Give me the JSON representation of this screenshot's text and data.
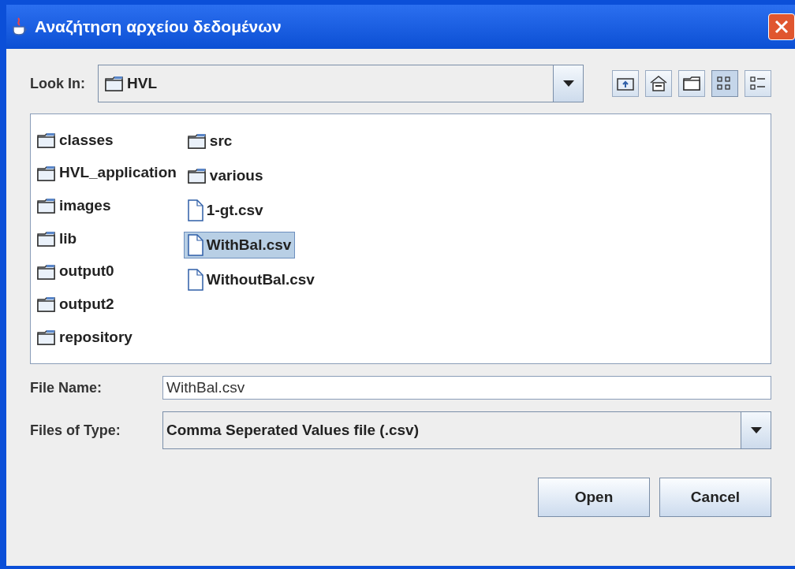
{
  "window": {
    "title": "Αναζήτηση αρχείου δεδομένων"
  },
  "look_in": {
    "label": "Look In:",
    "value": "HVL"
  },
  "toolbar": [
    {
      "kind": "up",
      "selected": false
    },
    {
      "kind": "home",
      "selected": false
    },
    {
      "kind": "new-folder",
      "selected": false
    },
    {
      "kind": "list",
      "selected": true
    },
    {
      "kind": "details",
      "selected": false
    }
  ],
  "files": [
    {
      "name": "classes",
      "kind": "folder",
      "selected": false
    },
    {
      "name": "HVL_application",
      "kind": "folder",
      "selected": false
    },
    {
      "name": "images",
      "kind": "folder",
      "selected": false
    },
    {
      "name": "lib",
      "kind": "folder",
      "selected": false
    },
    {
      "name": "output0",
      "kind": "folder",
      "selected": false
    },
    {
      "name": "output2",
      "kind": "folder",
      "selected": false
    },
    {
      "name": "repository",
      "kind": "folder",
      "selected": false
    },
    {
      "name": "src",
      "kind": "folder",
      "selected": false
    },
    {
      "name": "various",
      "kind": "folder",
      "selected": false
    },
    {
      "name": "1-gt.csv",
      "kind": "file",
      "selected": false
    },
    {
      "name": "WithBal.csv",
      "kind": "file",
      "selected": true
    },
    {
      "name": "WithoutBal.csv",
      "kind": "file",
      "selected": false
    }
  ],
  "file_name": {
    "label": "File Name:",
    "value": "WithBal.csv"
  },
  "file_type": {
    "label": "Files of Type:",
    "value": "Comma Seperated Values file (.csv)"
  },
  "buttons": [
    "Open",
    "Cancel"
  ]
}
